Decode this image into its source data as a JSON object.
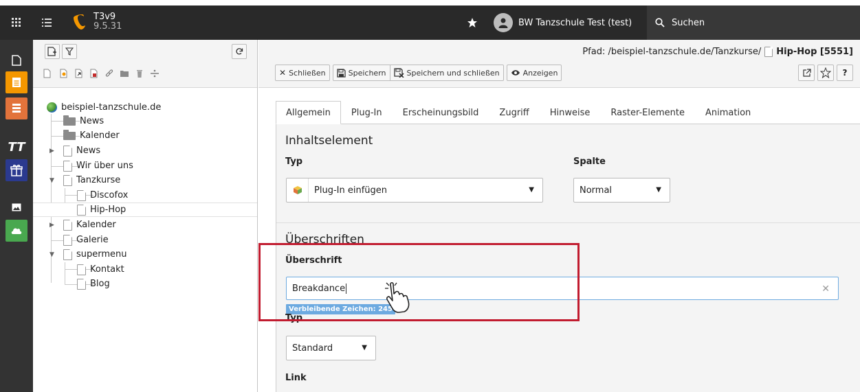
{
  "topbar": {
    "app_title": "T3v9",
    "app_version": "9.5.31",
    "user_name": "BW Tanzschule Test (test)",
    "search_label": "Suchen"
  },
  "page_tree": {
    "nodes": [
      {
        "label": "beispiel-tanzschule.de",
        "type": "root"
      },
      {
        "label": "News",
        "type": "folder"
      },
      {
        "label": "Kalender",
        "type": "folder"
      },
      {
        "label": "News",
        "type": "page",
        "caret": "▶"
      },
      {
        "label": "Wir über uns",
        "type": "page"
      },
      {
        "label": "Tanzkurse",
        "type": "page",
        "caret": "▼"
      },
      {
        "label": "Discofox",
        "type": "page"
      },
      {
        "label": "Hip-Hop",
        "type": "page",
        "selected": true
      },
      {
        "label": "Kalender",
        "type": "page",
        "caret": "▶"
      },
      {
        "label": "Galerie",
        "type": "page"
      },
      {
        "label": "supermenu",
        "type": "page",
        "caret": "▼"
      },
      {
        "label": "Kontakt",
        "type": "page"
      },
      {
        "label": "Blog",
        "type": "page"
      }
    ]
  },
  "docheader": {
    "path_prefix": "Pfad: /beispiel-tanzschule.de/Tanzkurse/",
    "path_title": "Hip-Hop [5551]",
    "buttons": {
      "close": "Schließen",
      "save": "Speichern",
      "save_close": "Speichern und schließen",
      "view": "Anzeigen"
    },
    "help": "?"
  },
  "tabs": [
    "Allgemein",
    "Plug-In",
    "Erscheinungsbild",
    "Zugriff",
    "Hinweise",
    "Raster-Elemente",
    "Animation"
  ],
  "form": {
    "section1_title": "Inhaltselement",
    "typ_label": "Typ",
    "typ_value": "Plug-In einfügen",
    "spalte_label": "Spalte",
    "spalte_value": "Normal",
    "section2_title": "Überschriften",
    "header_label": "Überschrift",
    "header_value": "Breakdance",
    "remaining_chars": "Verbleibende Zeichen: 245",
    "header_type_label": "Typ",
    "header_type_value": "Standard",
    "link_label": "Link"
  },
  "colors": {
    "topbar": "#292929",
    "highlight": "#c11b2f",
    "accent": "#6daae0",
    "typo3_orange": "#f49700"
  }
}
